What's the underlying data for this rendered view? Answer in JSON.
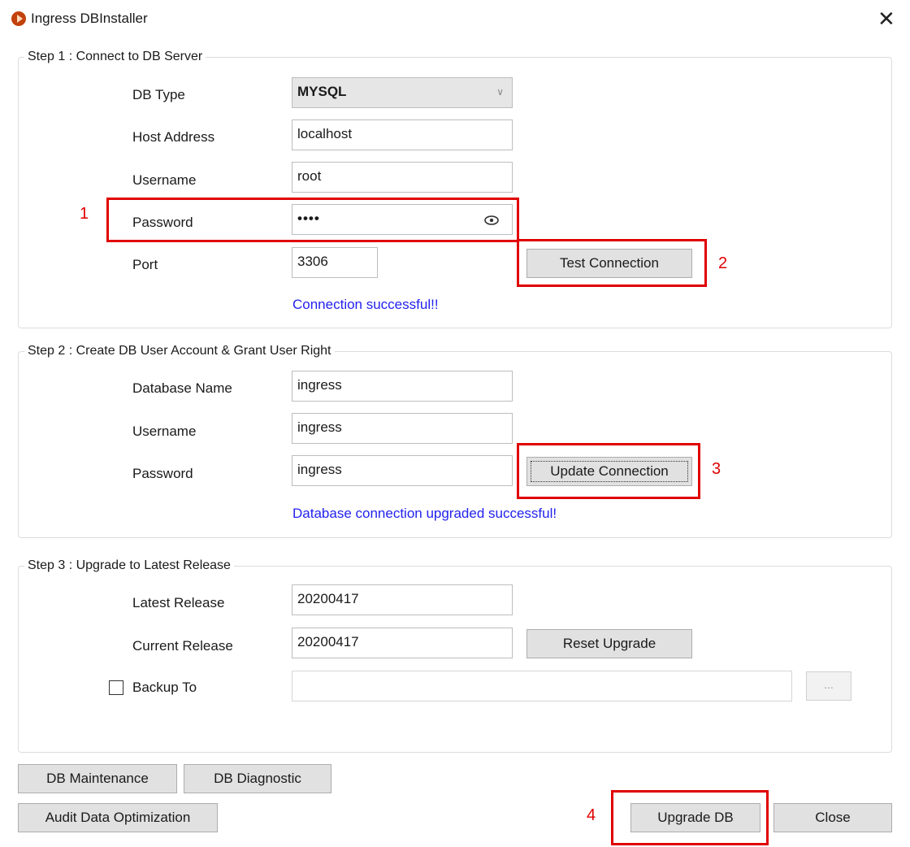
{
  "window": {
    "title": "Ingress DBInstaller",
    "close_symbol": "✕"
  },
  "step1": {
    "legend": "Step 1 : Connect to DB Server",
    "db_type_label": "DB Type",
    "db_type_value": "MYSQL",
    "host_label": "Host Address",
    "host_value": "localhost",
    "username_label": "Username",
    "username_value": "root",
    "password_label": "Password",
    "password_value": "••••",
    "port_label": "Port",
    "port_value": "3306",
    "test_button": "Test Connection",
    "status": "Connection successful!!"
  },
  "step2": {
    "legend": "Step 2 : Create DB User Account & Grant User Right",
    "dbname_label": "Database Name",
    "dbname_value": "ingress",
    "username_label": "Username",
    "username_value": "ingress",
    "password_label": "Password",
    "password_value": "ingress",
    "update_button": "Update Connection",
    "status": "Database connection upgraded successful!"
  },
  "step3": {
    "legend": "Step 3 : Upgrade to Latest Release",
    "latest_label": "Latest Release",
    "latest_value": "20200417",
    "current_label": "Current Release",
    "current_value": "20200417",
    "reset_button": "Reset Upgrade",
    "backup_label": "Backup To",
    "backup_value": "",
    "browse_button": "..."
  },
  "bottom": {
    "maintenance_button": "DB Maintenance",
    "diagnostic_button": "DB Diagnostic",
    "audit_button": "Audit Data Optimization",
    "upgrade_button": "Upgrade DB",
    "close_button": "Close"
  },
  "annotations": [
    "1",
    "2",
    "3",
    "4"
  ],
  "colors": {
    "annotation": "#e00000",
    "status": "#2222ee",
    "icon": "#c2410c"
  },
  "icons": {
    "app": "app-logo-icon",
    "eye": "eye-icon",
    "dropdown": "chevron-down-icon"
  }
}
